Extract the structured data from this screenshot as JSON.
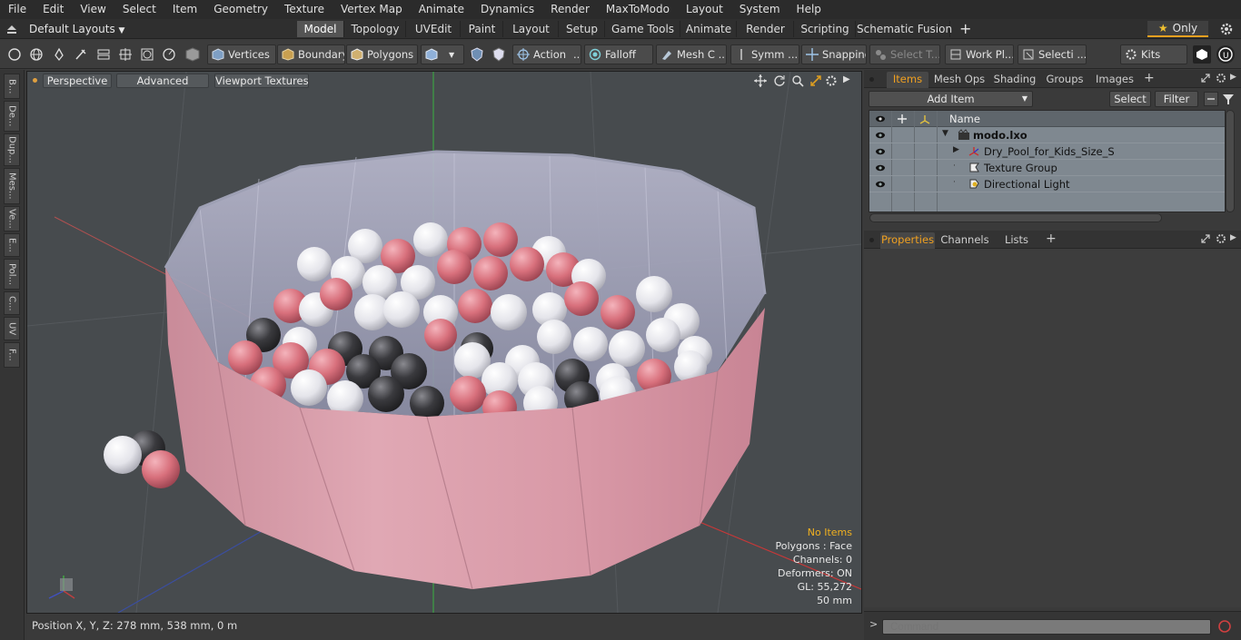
{
  "menubar": {
    "items": [
      "File",
      "Edit",
      "View",
      "Select",
      "Item",
      "Geometry",
      "Texture",
      "Vertex Map",
      "Animate",
      "Dynamics",
      "Render",
      "MaxToModo",
      "Layout",
      "System",
      "Help"
    ]
  },
  "layoutbar": {
    "layout_select": "Default Layouts",
    "tabs": [
      "Model",
      "Topology",
      "UVEdit",
      "Paint",
      "Layout",
      "Setup",
      "Game Tools",
      "Animate",
      "Render",
      "Scripting",
      "Schematic Fusion"
    ],
    "active_tab": "Model",
    "only_label": "Only"
  },
  "toolbar": {
    "vertices": "Vertices",
    "boundary": "Boundary",
    "polygons": "Polygons",
    "action": "Action",
    "falloff": "Falloff",
    "mesh": "Mesh C ...",
    "symmetry": "Symm ...",
    "snapping": "Snapping",
    "select_through": "Select T...",
    "work_plane": "Work Pl...",
    "selection": "Selecti ...",
    "kits": "Kits"
  },
  "leftstrip": {
    "tabs": [
      "B...",
      "De...",
      "Dup...",
      "Mes...",
      "Ve...",
      "E...",
      "Pol...",
      "C...",
      "UV",
      "F..."
    ]
  },
  "viewport": {
    "perspective": "Perspective",
    "advanced": "Advanced",
    "viewport_textures": "Viewport Textures",
    "hud": {
      "selection": "No Items",
      "polygons": "Polygons : Face",
      "channels": "Channels: 0",
      "deformers": "Deformers: ON",
      "gl": "GL: 55,272",
      "unit": "50 mm"
    }
  },
  "statusbar": {
    "position": "Position X, Y, Z:   278 mm, 538 mm, 0 m"
  },
  "items_panel": {
    "tabs": [
      "Items",
      "Mesh Ops",
      "Shading",
      "Groups",
      "Images"
    ],
    "active_tab": "Items",
    "add_item": "Add Item",
    "select": "Select",
    "filter": "Filter",
    "name_header": "Name",
    "rows": [
      {
        "label": "modo.lxo",
        "icon": "scene-icon"
      },
      {
        "label": "Dry_Pool_for_Kids_Size_S",
        "icon": "mesh-locator-icon"
      },
      {
        "label": "Texture Group",
        "icon": "texture-group-icon"
      },
      {
        "label": "Directional Light",
        "icon": "directional-light-icon"
      }
    ]
  },
  "properties_panel": {
    "tabs": [
      "Properties",
      "Channels",
      "Lists"
    ],
    "active_tab": "Properties"
  },
  "command": {
    "placeholder": "Command"
  },
  "colors": {
    "accent": "#f0a020",
    "viewport_bg": "#474b4e",
    "pool_pink": "#d9a2ae",
    "ball_pink": "#d9606f",
    "ball_white": "#eeeef2",
    "ball_black": "#2c2c2e"
  }
}
